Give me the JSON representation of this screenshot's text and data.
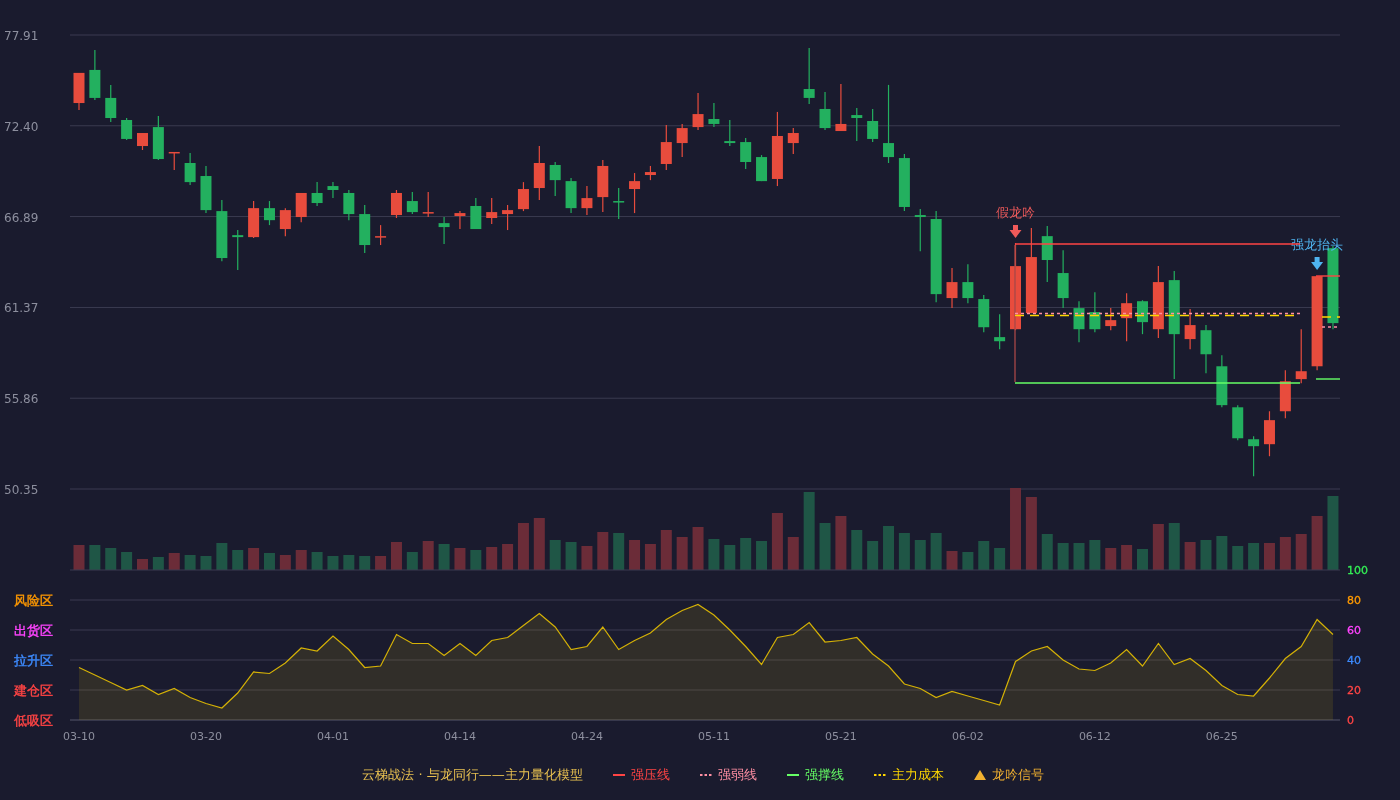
{
  "price_chart": {
    "chart_data": {
      "type": "candlestick",
      "grid": true,
      "ylim": [
        50.35,
        77.91
      ],
      "yticks": [
        {
          "value": 50.35,
          "label": "50.35"
        },
        {
          "value": 55.86,
          "label": "55.86"
        },
        {
          "value": 61.37,
          "label": "61.37"
        },
        {
          "value": 66.89,
          "label": "66.89"
        },
        {
          "value": 72.4,
          "label": "72.40"
        },
        {
          "value": 77.91,
          "label": "77.91"
        }
      ],
      "ohlc": [
        [
          73.78,
          75.61,
          73.36,
          75.61
        ],
        [
          75.79,
          77.0,
          73.97,
          74.09
        ],
        [
          74.09,
          74.88,
          72.63,
          72.87
        ],
        [
          72.75,
          72.87,
          71.54,
          71.6
        ],
        [
          71.17,
          71.96,
          70.93,
          71.96
        ],
        [
          72.32,
          72.99,
          70.32,
          70.38
        ],
        [
          70.75,
          70.81,
          69.71,
          70.81
        ],
        [
          70.14,
          70.75,
          68.8,
          68.98
        ],
        [
          69.35,
          69.96,
          67.1,
          67.28
        ],
        [
          67.22,
          67.89,
          64.18,
          64.37
        ],
        [
          65.76,
          66.07,
          63.64,
          65.64
        ],
        [
          65.64,
          67.83,
          65.58,
          67.4
        ],
        [
          67.4,
          67.83,
          66.37,
          66.67
        ],
        [
          66.13,
          67.4,
          65.7,
          67.28
        ],
        [
          66.86,
          68.32,
          66.55,
          68.32
        ],
        [
          68.32,
          68.98,
          67.53,
          67.71
        ],
        [
          68.74,
          68.98,
          68.01,
          68.5
        ],
        [
          68.32,
          68.5,
          66.67,
          67.04
        ],
        [
          67.04,
          67.59,
          64.67,
          65.16
        ],
        [
          65.64,
          66.37,
          65.16,
          65.7
        ],
        [
          66.98,
          68.5,
          66.8,
          68.32
        ],
        [
          67.83,
          68.38,
          67.04,
          67.16
        ],
        [
          67.1,
          68.38,
          66.86,
          67.16
        ],
        [
          66.49,
          66.86,
          65.22,
          66.25
        ],
        [
          66.92,
          67.22,
          66.13,
          67.1
        ],
        [
          67.53,
          68.01,
          66.13,
          66.13
        ],
        [
          66.8,
          68.01,
          66.43,
          67.16
        ],
        [
          67.04,
          67.59,
          66.07,
          67.28
        ],
        [
          67.34,
          68.98,
          67.22,
          68.56
        ],
        [
          68.62,
          71.17,
          67.89,
          70.14
        ],
        [
          70.02,
          70.2,
          68.13,
          69.1
        ],
        [
          69.04,
          69.23,
          67.1,
          67.4
        ],
        [
          67.4,
          68.74,
          66.98,
          68.01
        ],
        [
          68.07,
          70.32,
          67.16,
          69.96
        ],
        [
          67.83,
          68.62,
          66.74,
          67.77
        ],
        [
          68.56,
          69.53,
          67.1,
          69.04
        ],
        [
          69.41,
          69.96,
          69.1,
          69.59
        ],
        [
          70.08,
          72.45,
          69.71,
          71.41
        ],
        [
          71.35,
          72.51,
          70.5,
          72.26
        ],
        [
          72.32,
          74.39,
          72.14,
          73.11
        ],
        [
          72.81,
          73.78,
          72.32,
          72.51
        ],
        [
          71.47,
          72.75,
          71.17,
          71.35
        ],
        [
          71.41,
          71.66,
          69.77,
          70.2
        ],
        [
          70.5,
          70.62,
          69.04,
          69.04
        ],
        [
          69.17,
          73.24,
          68.74,
          71.78
        ],
        [
          71.35,
          72.26,
          70.68,
          71.96
        ],
        [
          74.63,
          77.12,
          73.72,
          74.09
        ],
        [
          73.42,
          74.45,
          72.14,
          72.26
        ],
        [
          72.08,
          74.94,
          72.08,
          72.51
        ],
        [
          73.05,
          73.48,
          71.47,
          72.87
        ],
        [
          72.69,
          73.42,
          71.41,
          71.6
        ],
        [
          71.35,
          74.88,
          70.14,
          70.5
        ],
        [
          70.44,
          70.68,
          67.22,
          67.47
        ],
        [
          66.98,
          67.34,
          64.79,
          66.86
        ],
        [
          66.74,
          67.22,
          61.69,
          62.18
        ],
        [
          61.94,
          63.76,
          61.33,
          62.91
        ],
        [
          62.91,
          64.0,
          61.63,
          61.94
        ],
        [
          61.88,
          62.12,
          59.87,
          60.17
        ],
        [
          59.57,
          60.96,
          58.84,
          59.32
        ],
        [
          60.05,
          65.28,
          59.99,
          63.88
        ],
        [
          61.03,
          66.19,
          61.03,
          64.43
        ],
        [
          65.7,
          66.31,
          62.91,
          64.25
        ],
        [
          63.46,
          64.85,
          61.33,
          61.94
        ],
        [
          61.33,
          61.75,
          59.26,
          60.05
        ],
        [
          61.09,
          62.3,
          59.87,
          60.05
        ],
        [
          60.24,
          61.33,
          59.99,
          60.6
        ],
        [
          60.72,
          62.24,
          59.32,
          61.63
        ],
        [
          61.75,
          61.81,
          59.75,
          60.48
        ],
        [
          60.05,
          63.88,
          59.51,
          62.91
        ],
        [
          63.03,
          63.58,
          57.02,
          59.75
        ],
        [
          59.45,
          61.27,
          58.84,
          60.3
        ],
        [
          59.99,
          60.3,
          57.38,
          58.53
        ],
        [
          57.8,
          58.47,
          55.31,
          55.44
        ],
        [
          55.31,
          55.44,
          53.31,
          53.43
        ],
        [
          53.37,
          53.55,
          51.12,
          52.95
        ],
        [
          53.07,
          55.07,
          52.34,
          54.53
        ],
        [
          55.07,
          57.56,
          54.65,
          56.89
        ],
        [
          57.02,
          60.05,
          56.77,
          57.5
        ],
        [
          57.8,
          63.27,
          57.56,
          63.27
        ],
        [
          64.97,
          65.1,
          60.05,
          60.42
        ]
      ],
      "annotations": [
        "假龙吟",
        "强龙抬头"
      ]
    },
    "signals": [
      {
        "color": "#f05a5a"
      },
      {
        "color": "#4fb4f0"
      }
    ]
  },
  "indicator_chart": {
    "zones": [
      {
        "label": "风险区",
        "color": "#ff9900"
      },
      {
        "label": "出货区",
        "color": "#ff44ff"
      },
      {
        "label": "拉升区",
        "color": "#3d8bff"
      },
      {
        "label": "建仓区",
        "color": "#ff4444"
      },
      {
        "label": "低吸区",
        "color": "#ff4444"
      }
    ],
    "tick_labels": [
      {
        "color": "#ff4444"
      },
      {
        "color": "#ff4444"
      },
      {
        "color": "#3d8bff"
      },
      {
        "color": "#ff44ff"
      },
      {
        "color": "#ff9900"
      },
      {
        "color": "#33ee55"
      }
    ],
    "chart_data": {
      "type": "area",
      "grid": true,
      "ylim": [
        0,
        100
      ],
      "categories": [
        "03-10",
        null,
        null,
        null,
        null,
        null,
        null,
        null,
        "03-20",
        null,
        null,
        null,
        null,
        null,
        null,
        null,
        "04-01",
        null,
        null,
        null,
        null,
        null,
        null,
        null,
        "04-14",
        null,
        null,
        null,
        null,
        null,
        null,
        null,
        "04-24",
        null,
        null,
        null,
        null,
        null,
        null,
        null,
        "05-11",
        null,
        null,
        null,
        null,
        null,
        null,
        null,
        "05-21",
        null,
        null,
        null,
        null,
        null,
        null,
        null,
        "06-02",
        null,
        null,
        null,
        null,
        null,
        null,
        null,
        "06-12",
        null,
        null,
        null,
        null,
        null,
        null,
        null,
        "06-25",
        null,
        null,
        null,
        null,
        null,
        null,
        null
      ],
      "series": [
        {
          "color": "#d4b106",
          "values": [
            35,
            30,
            25,
            20,
            23,
            17,
            21,
            15,
            11,
            8,
            18,
            32,
            31,
            38,
            48,
            46,
            56,
            47,
            35,
            36,
            57,
            51,
            51,
            43,
            51,
            43,
            53,
            55,
            63,
            71,
            62,
            47,
            49,
            62,
            47,
            53,
            58,
            67,
            73,
            77,
            70,
            60,
            49,
            37,
            55,
            57,
            65,
            52,
            53,
            55,
            44,
            36,
            24,
            21,
            15,
            19,
            16,
            13,
            10,
            39,
            46,
            49,
            40,
            34,
            33,
            38,
            47,
            36,
            51,
            37,
            41,
            33,
            23,
            17,
            16,
            28,
            41,
            49,
            67,
            57
          ]
        }
      ],
      "yticks": [
        0,
        20,
        40,
        60,
        80,
        100
      ]
    }
  },
  "legend": {
    "title": "云梯战法 · 与龙同行——主力量化模型",
    "items": [
      {
        "kind": "solid",
        "label": "强压线",
        "color": "#ff4444"
      },
      {
        "kind": "dashed",
        "label": "强弱线",
        "color": "#ff8fa3"
      },
      {
        "kind": "solid",
        "label": "强撑线",
        "color": "#66ff66"
      },
      {
        "kind": "dashed",
        "label": "主力成本",
        "color": "#ffd700"
      },
      {
        "kind": "triangle",
        "label": "龙吟信号",
        "color": "#f0b030"
      }
    ]
  }
}
